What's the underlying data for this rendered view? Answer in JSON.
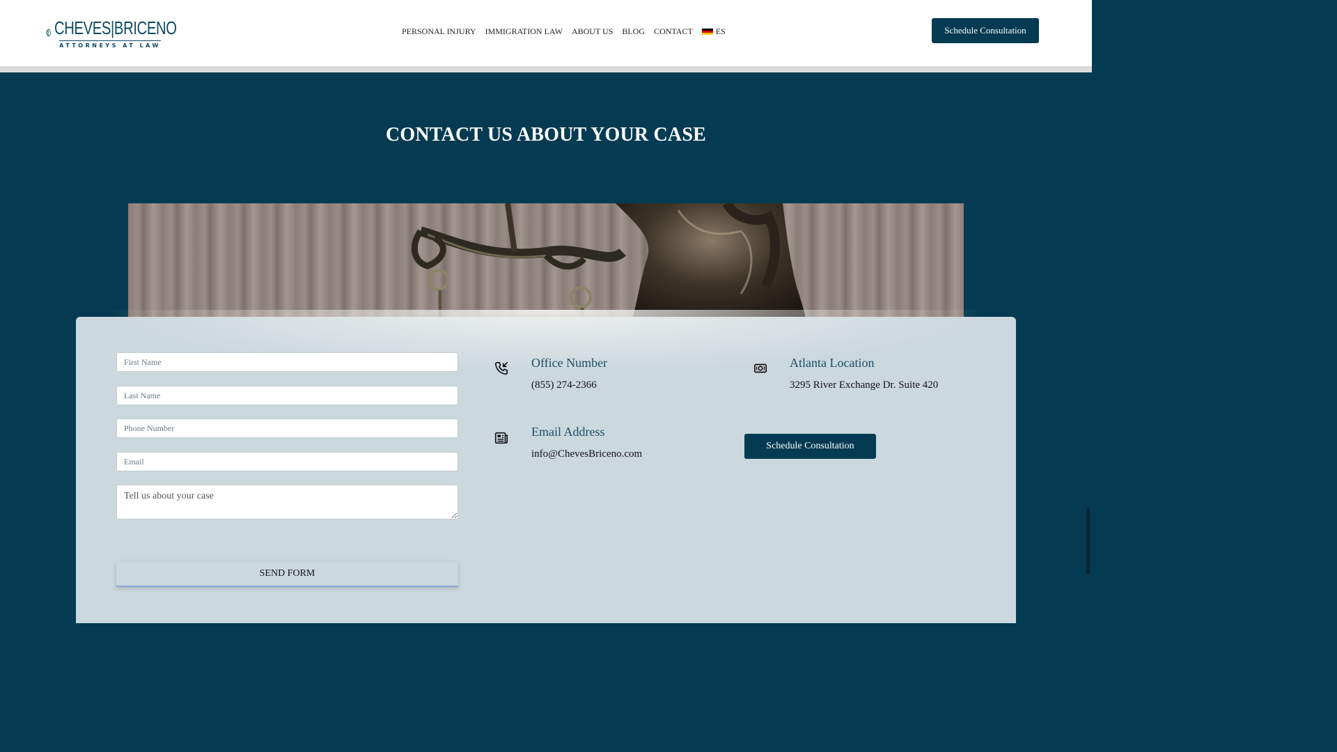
{
  "header": {
    "logo": {
      "name": "CHEVES|BRICENO",
      "tagline": "ATTORNEYS AT LAW"
    },
    "nav": [
      {
        "label": "PERSONAL INJURY"
      },
      {
        "label": "IMMIGRATION LAW"
      },
      {
        "label": "ABOUT US"
      },
      {
        "label": "BLOG"
      },
      {
        "label": "CONTACT"
      }
    ],
    "language": {
      "label": "ES",
      "flag_icon": "germany-flag-icon"
    },
    "cta_label": "Schedule Consultation"
  },
  "section": {
    "title": "CONTACT US ABOUT YOUR CASE"
  },
  "form": {
    "first_name_placeholder": "First Name",
    "last_name_placeholder": "Last Name",
    "phone_placeholder": "Phone Number",
    "email_placeholder": "Email",
    "message_placeholder": "Tell us about your case",
    "submit_label": "SEND FORM"
  },
  "contact_info": {
    "office": {
      "title": "Office Number",
      "value": "(855) 274-2366",
      "icon": "phone-incoming-icon"
    },
    "email": {
      "title": "Email Address",
      "value": "info@ChevesBriceno.com",
      "icon": "newspaper-icon"
    },
    "location": {
      "title": "Atlanta Location",
      "value": "3295 River Exchange Dr. Suite 420",
      "icon": "money-bill-icon"
    },
    "cta_label": "Schedule Consultation"
  },
  "colors": {
    "brand_dark": "#043b52",
    "card_bg": "#cbd8de",
    "title_blue": "#1b4e66"
  }
}
